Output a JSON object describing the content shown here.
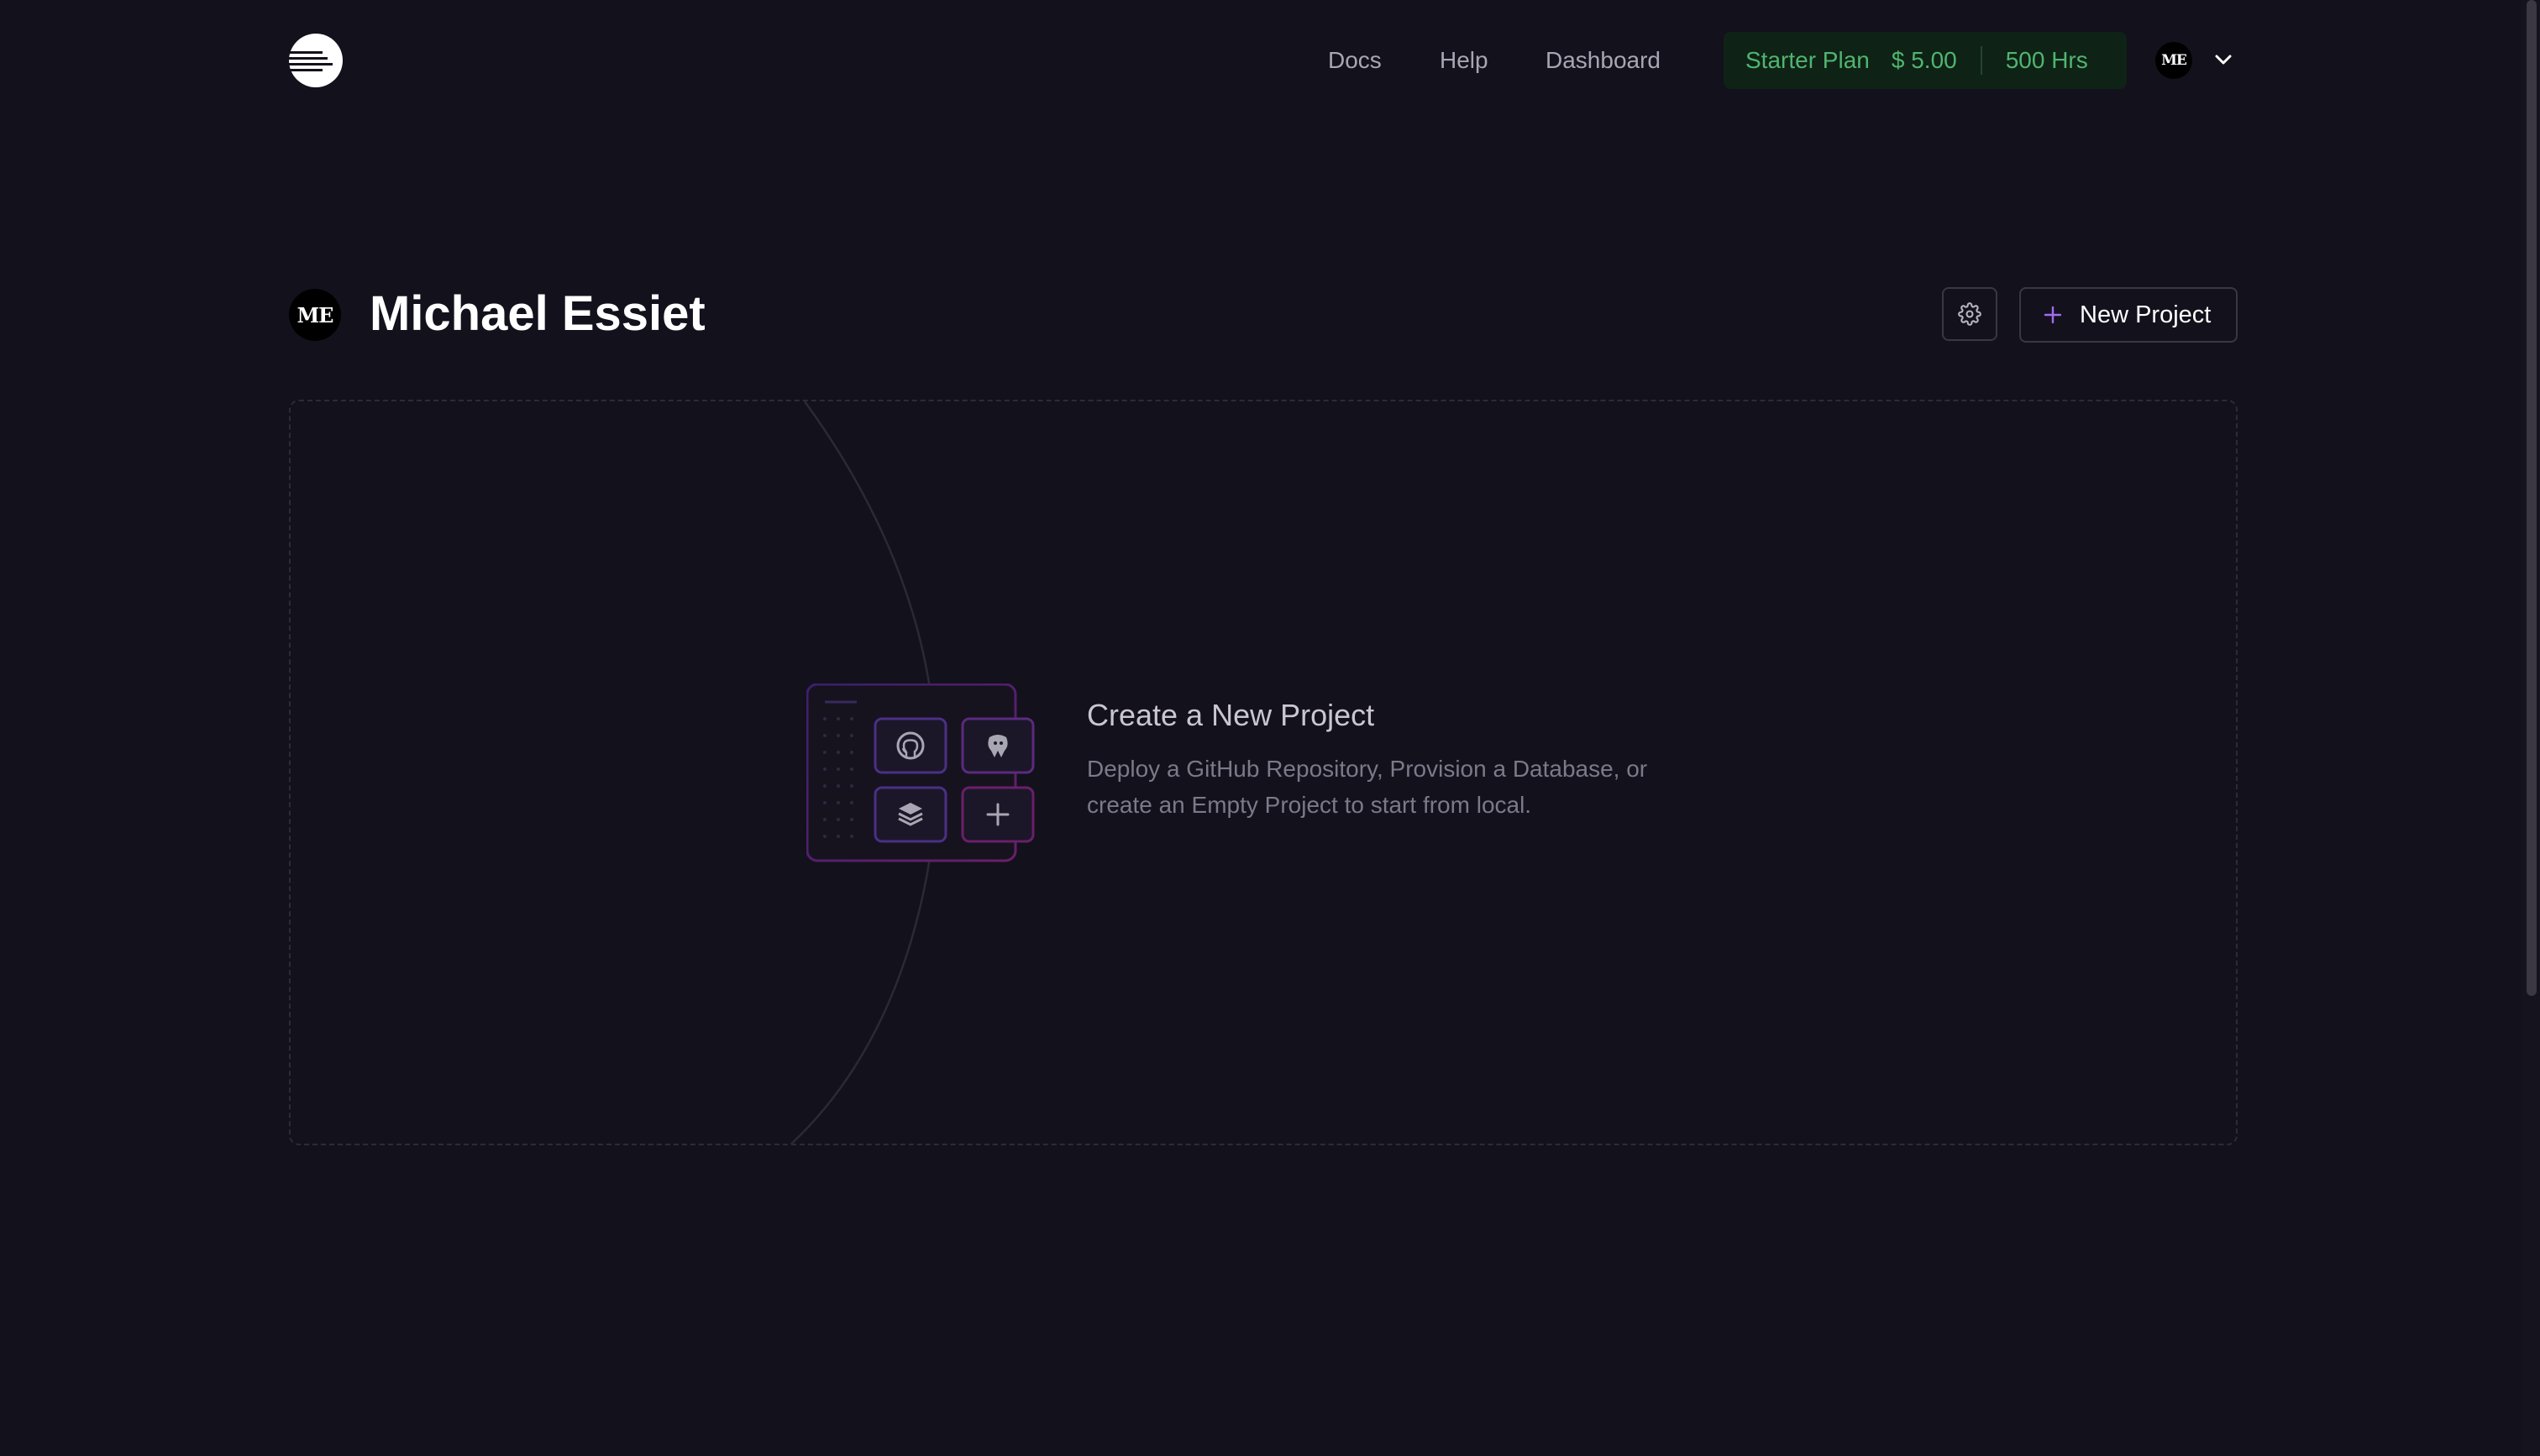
{
  "header": {
    "nav": {
      "docs": "Docs",
      "help": "Help",
      "dashboard": "Dashboard"
    },
    "plan": {
      "name": "Starter Plan",
      "price": "$ 5.00",
      "hours": "500 Hrs"
    },
    "user_initials": "ME"
  },
  "page": {
    "title": "Michael Essiet",
    "new_project_label": "New Project"
  },
  "empty_state": {
    "title": "Create a New Project",
    "description_line1": "Deploy a GitHub Repository, Provision a Database, or",
    "description_line2": "create an Empty Project to start from local."
  },
  "icons": [
    "railway-logo-icon",
    "chevron-down-icon",
    "gear-icon",
    "plus-icon",
    "github-icon",
    "postgres-icon",
    "layers-icon"
  ],
  "colors": {
    "background": "#13111c",
    "plan_text": "#4fb56f",
    "plan_bg": "#0f2216",
    "accent_purple": "#8b5cf6"
  }
}
